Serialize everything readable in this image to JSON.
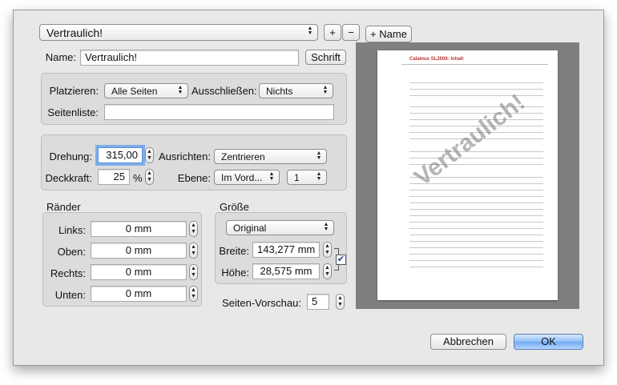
{
  "preset": {
    "selected": "Vertraulich!",
    "add_label": "+",
    "remove_label": "−",
    "add_name_label": "+ Name"
  },
  "name_row": {
    "label": "Name:",
    "value": "Vertraulich!",
    "font_button": "Schrift"
  },
  "placement": {
    "place_label": "Platzieren:",
    "place_value": "Alle Seiten",
    "exclude_label": "Ausschließen:",
    "exclude_value": "Nichts",
    "pagelist_label": "Seitenliste:",
    "pagelist_value": ""
  },
  "transform": {
    "rotation_label": "Drehung:",
    "rotation_value": "315,00",
    "align_label": "Ausrichten:",
    "align_value": "Zentrieren",
    "opacity_label": "Deckkraft:",
    "opacity_value": "25",
    "opacity_unit": "%",
    "layer_label": "Ebene:",
    "layer_value": "Im Vord...",
    "layer_index": "1"
  },
  "margins": {
    "title": "Ränder",
    "left_label": "Links:",
    "left_value": "0 mm",
    "top_label": "Oben:",
    "top_value": "0 mm",
    "right_label": "Rechts:",
    "right_value": "0 mm",
    "bottom_label": "Unten:",
    "bottom_value": "0 mm"
  },
  "size": {
    "title": "Größe",
    "mode_value": "Original",
    "width_label": "Breite:",
    "width_value": "143,277 mm",
    "height_label": "Höhe:",
    "height_value": "28,575 mm",
    "proportional_checked": true
  },
  "preview": {
    "pages_label": "Seiten-Vorschau:",
    "pages_value": "5",
    "doc_header": "Calamus SL2006: Inhalt",
    "watermark_text": "Vertraulich!"
  },
  "actions": {
    "cancel_label": "Abbrechen",
    "ok_label": "OK"
  }
}
